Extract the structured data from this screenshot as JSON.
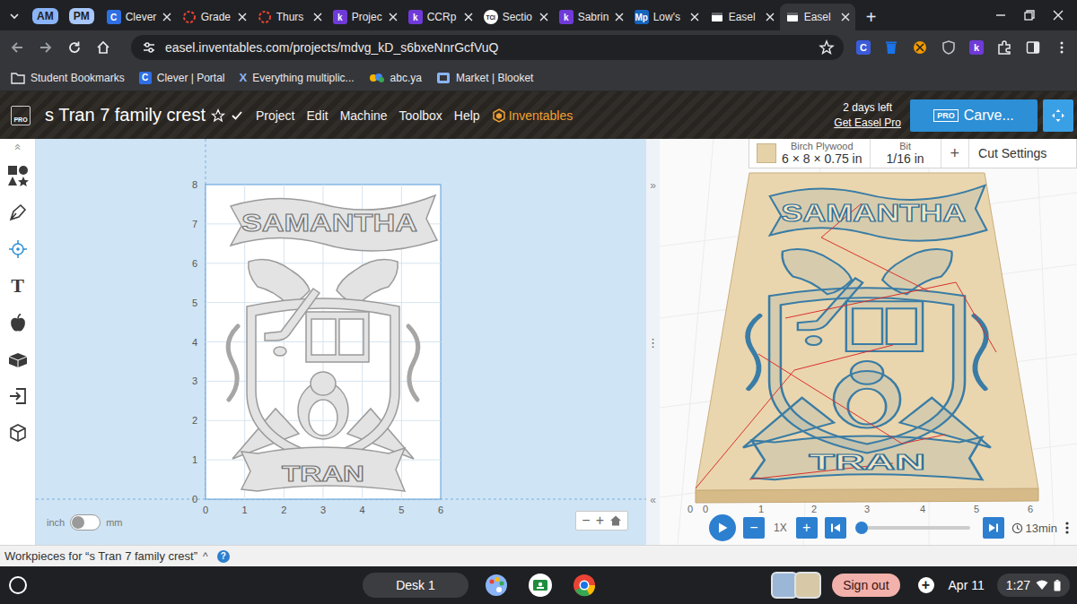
{
  "browser": {
    "tab_groups": [
      {
        "label": "AM",
        "color": "#8ab4f8"
      },
      {
        "label": "PM",
        "color": "#a8c7fa"
      }
    ],
    "tabs": [
      {
        "label": "Clever",
        "kind": "letter",
        "favicon": "C",
        "color": "#2f6fe4",
        "selected": false
      },
      {
        "label": "Grade",
        "kind": "ring",
        "color": "#ea4335",
        "selected": false
      },
      {
        "label": "Thurs",
        "kind": "ring",
        "color": "#ea4335",
        "selected": false
      },
      {
        "label": "Projec",
        "kind": "letter",
        "favicon": "k",
        "color": "#6f3ad8",
        "selected": false
      },
      {
        "label": "CCRp",
        "kind": "letter",
        "favicon": "k",
        "color": "#6f3ad8",
        "selected": false
      },
      {
        "label": "Sectio",
        "kind": "badge",
        "favicon": "TCI",
        "color": "#ffffff",
        "selected": false
      },
      {
        "label": "Sabrin",
        "kind": "letter",
        "favicon": "k",
        "color": "#6f3ad8",
        "selected": false
      },
      {
        "label": "Low's",
        "kind": "letter",
        "favicon": "Mp",
        "color": "#1565c0",
        "selected": false
      },
      {
        "label": "Easel",
        "kind": "page",
        "color": "#ffffff",
        "selected": false
      },
      {
        "label": "Easel",
        "kind": "page",
        "color": "#ffffff",
        "selected": true
      }
    ],
    "new_tab": "+",
    "url": "easel.inventables.com/projects/mdvg_kD_s6bxeNnrGcfVuQ",
    "extensions": [
      {
        "kind": "letter",
        "label": "C",
        "color": "#3b5bdb"
      },
      {
        "kind": "trash",
        "color": "#1a73e8"
      },
      {
        "kind": "dot",
        "color": "#f29900"
      },
      {
        "kind": "shield",
        "color": "#bdc1c6"
      },
      {
        "kind": "letter",
        "label": "k",
        "color": "#6f3ad8"
      },
      {
        "kind": "puzzle",
        "color": "#e8eaed"
      }
    ],
    "bookmarks": [
      {
        "label": "Student Bookmarks",
        "kind": "folder"
      },
      {
        "label": "Clever | Portal",
        "kind": "letter",
        "icon": "C"
      },
      {
        "label": "Everything multiplic...",
        "kind": "x",
        "icon": "X"
      },
      {
        "label": "abc.ya",
        "kind": "art"
      },
      {
        "label": "Market | Blooket",
        "kind": "box"
      }
    ]
  },
  "easel": {
    "logo": "PRO",
    "title": "s Tran 7 family crest",
    "starred": false,
    "saved": true,
    "menus": [
      "Project",
      "Edit",
      "Machine",
      "Toolbox",
      "Help"
    ],
    "brand": "Inventables",
    "trial": "2 days left",
    "upgrade": "Get Easel Pro",
    "carve_badge": "PRO",
    "carve": "Carve..."
  },
  "toolbar": {
    "collapse": "«",
    "tools": [
      {
        "kind": "shapes",
        "selected": false
      },
      {
        "kind": "pen",
        "selected": false
      },
      {
        "kind": "target",
        "selected": true
      },
      {
        "kind": "text",
        "label": "T",
        "selected": false
      },
      {
        "kind": "apple",
        "selected": false
      },
      {
        "kind": "blocks",
        "selected": false
      },
      {
        "kind": "import",
        "selected": false
      },
      {
        "kind": "cube",
        "selected": false
      }
    ]
  },
  "design": {
    "x_ticks": [
      "0",
      "1",
      "2",
      "3",
      "4",
      "5",
      "6"
    ],
    "y_ticks": [
      "0",
      "1",
      "2",
      "3",
      "4",
      "5",
      "6",
      "7",
      "8"
    ],
    "top_banner": "SAMANTHA",
    "bottom_banner": "TRAN"
  },
  "divider": {
    "expand": "»",
    "handle": "⋮",
    "collapse": "«"
  },
  "units": {
    "left": "inch",
    "right": "mm",
    "on": false
  },
  "zoom": {
    "out": "−",
    "in": "+"
  },
  "preview": {
    "material": {
      "name": "Birch Plywood",
      "size": "6 × 8 × 0.75 in"
    },
    "bit": {
      "label": "Bit",
      "value": "1/16 in"
    },
    "add": "+",
    "cut_settings": "Cut Settings",
    "corner": "0",
    "x_ticks": [
      "0",
      "1",
      "2",
      "3",
      "4",
      "5",
      "6"
    ]
  },
  "playback": {
    "playing": false,
    "minus": "−",
    "speed": "1X",
    "plus": "+",
    "level": 0.03,
    "time": "13min"
  },
  "workpieces": {
    "label": "Workpieces for “s Tran 7 family crest”",
    "toggle": "^",
    "help": "?"
  },
  "shelf": {
    "desk": "Desk 1",
    "apps": [
      {
        "kind": "palette"
      },
      {
        "kind": "classroom"
      },
      {
        "kind": "chrome"
      }
    ],
    "sign_out": "Sign out",
    "add": "+",
    "date": "Apr 11",
    "time": "1:27"
  }
}
